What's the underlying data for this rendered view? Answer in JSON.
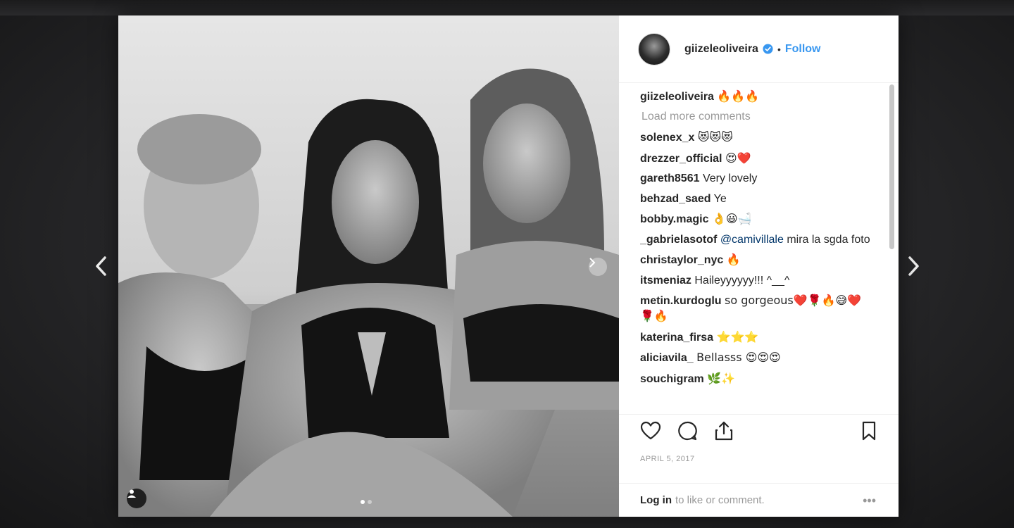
{
  "header": {
    "username": "giizeleoliveira",
    "separator": "•",
    "follow_label": "Follow"
  },
  "caption": {
    "username": "giizeleoliveira",
    "text": "🔥🔥🔥"
  },
  "load_more_label": "Load more comments",
  "comments": [
    {
      "user": "solenex_x",
      "text": "😻😻😻"
    },
    {
      "user": "drezzer_official",
      "text": "😍❤️"
    },
    {
      "user": "gareth8561",
      "text": "Very lovely"
    },
    {
      "user": "behzad_saed",
      "text": "Ye"
    },
    {
      "user": "bobby.magic",
      "text": "👌😃🛁"
    },
    {
      "user": "_gabrielasotof",
      "mention": "@camivillale",
      "text": "mira la sgda foto"
    },
    {
      "user": "christaylor_nyc",
      "text": "🔥"
    },
    {
      "user": "itsmeniaz",
      "text": "Haileyyyyyy!!! ^__^"
    },
    {
      "user": "metin.kurdoglu",
      "text": "so gorgeous❤️🌹🔥😅❤️🌹🔥"
    },
    {
      "user": "katerina_firsa",
      "text": "⭐⭐⭐"
    },
    {
      "user": "aliciavila_",
      "text": "Bellasss 😍😍😍"
    },
    {
      "user": "souchigram",
      "text": "🌿✨"
    }
  ],
  "date": "APRIL 5, 2017",
  "footer": {
    "login_label": "Log in",
    "login_rest": "to like or comment.",
    "more_label": "•••"
  },
  "icons": {
    "prev": "chevron-left-icon",
    "next": "chevron-right-icon",
    "like": "heart-icon",
    "comment": "comment-bubble-icon",
    "share": "share-icon",
    "save": "bookmark-icon",
    "verified": "verified-badge-icon",
    "tag": "user-tag-icon"
  },
  "colors": {
    "follow": "#3897f0",
    "verified": "#3897f0",
    "text": "#262626",
    "muted": "#999999"
  }
}
